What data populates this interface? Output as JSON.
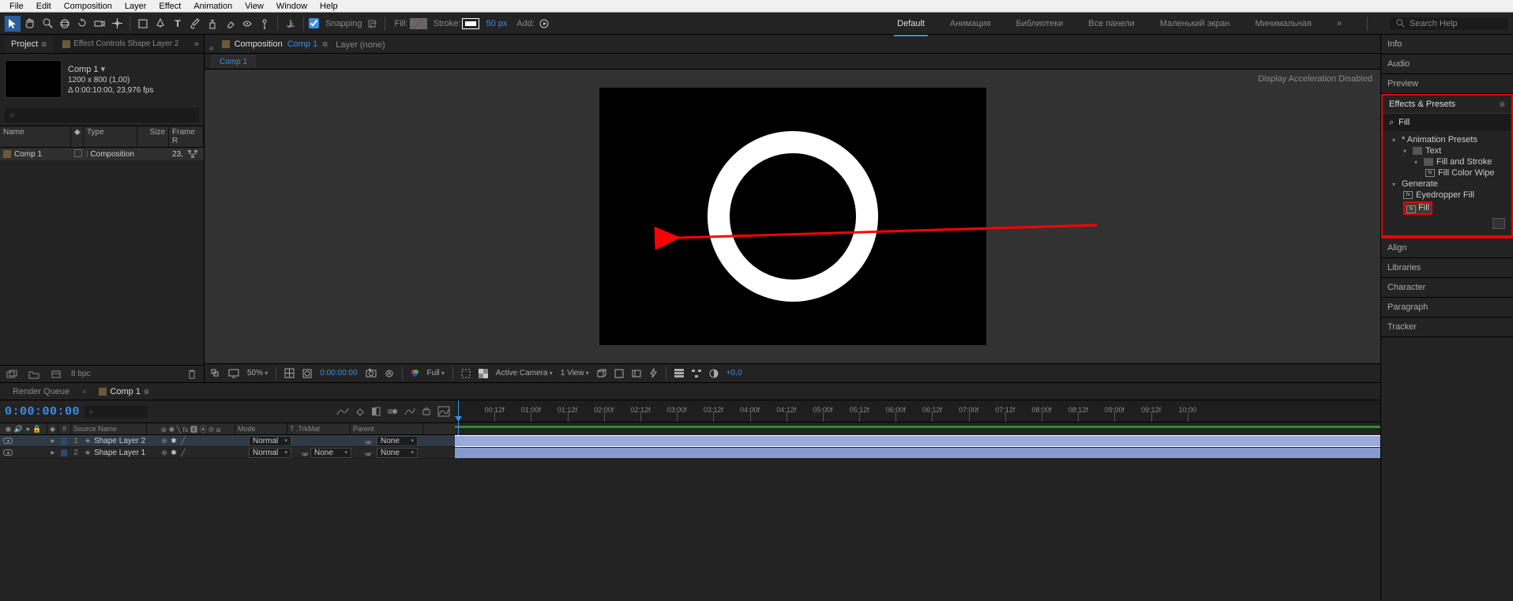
{
  "menu": {
    "items": [
      "File",
      "Edit",
      "Composition",
      "Layer",
      "Effect",
      "Animation",
      "View",
      "Window",
      "Help"
    ]
  },
  "toolbar": {
    "snapping": "Snapping",
    "fill_label": "Fill:",
    "stroke_label": "Stroke:",
    "stroke_px": "50 px",
    "add_label": "Add:",
    "workspaces": [
      "Default",
      "Анимация",
      "Библиотеки",
      "Все панели",
      "Маленький экран",
      "Минимальная"
    ],
    "ws_active": "Default",
    "chevrons": "»",
    "search_ph": "Search Help"
  },
  "project": {
    "tab_project": "Project",
    "tab_effect_controls": "Effect Controls Shape Layer 2",
    "comp_name": "Comp 1",
    "dims": "1200 x 800 (1,00)",
    "duration": "Δ 0:00:10:00, 23,976 fps",
    "columns": {
      "name": "Name",
      "type": "Type",
      "size": "Size",
      "frame": "Frame R"
    },
    "rows": [
      {
        "name": "Comp 1",
        "type": "Composition",
        "size": "",
        "frame": "23,"
      }
    ],
    "footer_bpc": "8 bpc"
  },
  "comp_viewer": {
    "prefix": "Composition",
    "name": "Comp 1",
    "layer_none": "Layer (none)",
    "subtab": "Comp 1",
    "accel": "Display Acceleration Disabled"
  },
  "viewer_footer": {
    "zoom": "50%",
    "time": "0:00:00:00",
    "res": "Full",
    "camera": "Active Camera",
    "view": "1 View",
    "exposure": "+0,0"
  },
  "timeline": {
    "tab_rq": "Render Queue",
    "tab_comp": "Comp 1",
    "timecode": "0:00:00:00",
    "columns": {
      "source": "Source Name",
      "mode": "Mode",
      "trkmat": "T .TrkMat",
      "parent": "Parent",
      "switches": "⊕ ✱ ╲ fx 🅱 ⦿ ⦾ ⧈"
    },
    "layers": [
      {
        "idx": "1",
        "name": "Shape Layer 2",
        "mode": "Normal",
        "parent": "None",
        "selected": true
      },
      {
        "idx": "2",
        "name": "Shape Layer 1",
        "mode": "Normal",
        "parent": "None",
        "selected": false
      }
    ],
    "ruler_ticks": [
      "00:12f",
      "01:00f",
      "01:12f",
      "02:00f",
      "02:12f",
      "03:00f",
      "03:12f",
      "04:00f",
      "04:12f",
      "05:00f",
      "05:12f",
      "06:00f",
      "06:12f",
      "07:00f",
      "07:12f",
      "08:00f",
      "08:12f",
      "09:00f",
      "09:12f",
      "10:00"
    ]
  },
  "right": {
    "panels": [
      "Info",
      "Audio",
      "Preview"
    ],
    "effects_title": "Effects & Presets",
    "search_value": "Fill",
    "anim_presets": "* Animation Presets",
    "text": "Text",
    "fill_stroke": "Fill and Stroke",
    "fill_color_wipe": "Fill Color Wipe",
    "generate": "Generate",
    "eyedropper_fill": "Eyedropper Fill",
    "fill": "Fill",
    "panels2": [
      "Align",
      "Libraries",
      "Character",
      "Paragraph",
      "Tracker"
    ]
  }
}
